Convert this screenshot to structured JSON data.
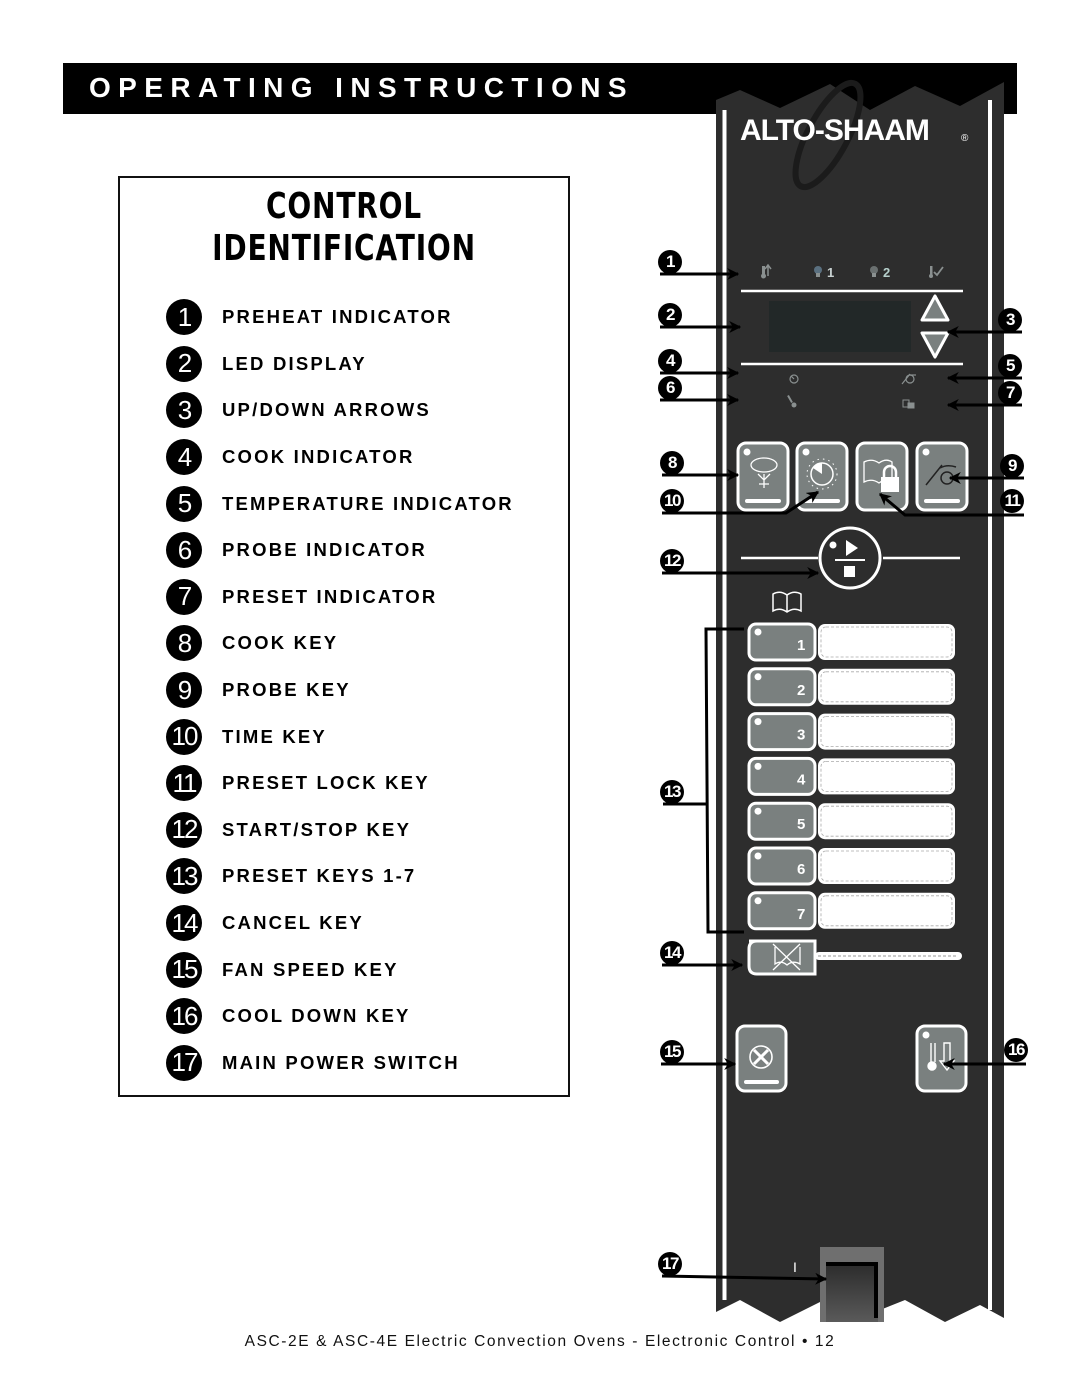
{
  "header": {
    "title": "OPERATING INSTRUCTIONS"
  },
  "legend": {
    "title_line1": "CONTROL",
    "title_line2": "IDENTIFICATION",
    "items": [
      {
        "num": "1",
        "label": "PREHEAT INDICATOR"
      },
      {
        "num": "2",
        "label": "LED DISPLAY"
      },
      {
        "num": "3",
        "label": "UP/DOWN ARROWS"
      },
      {
        "num": "4",
        "label": "COOK INDICATOR"
      },
      {
        "num": "5",
        "label": "TEMPERATURE INDICATOR"
      },
      {
        "num": "6",
        "label": "PROBE INDICATOR"
      },
      {
        "num": "7",
        "label": "PRESET INDICATOR"
      },
      {
        "num": "8",
        "label": "COOK KEY"
      },
      {
        "num": "9",
        "label": "PROBE KEY"
      },
      {
        "num": "10",
        "label": "TIME KEY"
      },
      {
        "num": "11",
        "label": "PRESET LOCK KEY"
      },
      {
        "num": "12",
        "label": "START/STOP KEY"
      },
      {
        "num": "13",
        "label": "PRESET KEYS 1-7"
      },
      {
        "num": "14",
        "label": "CANCEL KEY"
      },
      {
        "num": "15",
        "label": "FAN SPEED KEY"
      },
      {
        "num": "16",
        "label": "COOL DOWN KEY"
      },
      {
        "num": "17",
        "label": "MAIN POWER SWITCH"
      }
    ]
  },
  "panel": {
    "brand": "ALTO-SHAAM",
    "brand_mark": "®",
    "top_indicators": [
      {
        "icon": "preheat-icon",
        "label": ""
      },
      {
        "icon": "fan-icon",
        "label": "1"
      },
      {
        "icon": "fan-icon",
        "label": "2"
      },
      {
        "icon": "ready-check-icon",
        "label": ""
      }
    ],
    "led_display_value": "",
    "preset_keys": [
      "1",
      "2",
      "3",
      "4",
      "5",
      "6",
      "7"
    ],
    "power_switch_label": "I",
    "colors": {
      "panel": "#2d2d2d",
      "key": "#7a807f",
      "display": "#222828"
    }
  },
  "callouts": [
    "1",
    "2",
    "3",
    "4",
    "5",
    "6",
    "7",
    "8",
    "9",
    "10",
    "11",
    "12",
    "13",
    "14",
    "15",
    "16",
    "17"
  ],
  "footer": {
    "text": "ASC-2E & ASC-4E Electric Convection Ovens - Electronic Control • 12"
  }
}
